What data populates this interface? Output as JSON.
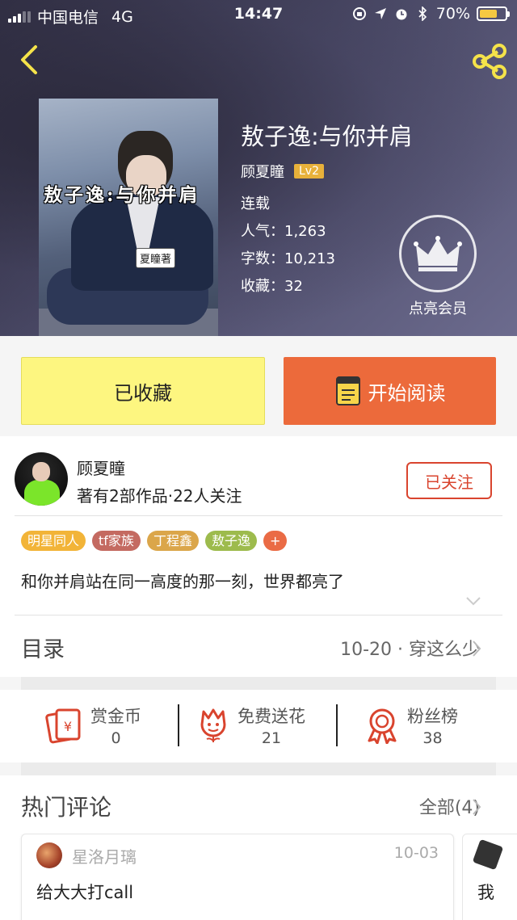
{
  "status_bar": {
    "carrier": "中国电信",
    "network": "4G",
    "time": "14:47",
    "battery": "70%",
    "battery_level": 0.7
  },
  "book": {
    "title": "敖子逸:与你并肩",
    "author": "顾夏瞳",
    "author_level": "Lv2",
    "status": "连载",
    "popularity": "人气：1,263",
    "word_count": "字数：10,213",
    "favorites": "收藏：32",
    "cover_title": "敖子逸:与你并肩",
    "cover_badge": "夏瞳著"
  },
  "vip": {
    "label": "点亮会员"
  },
  "actions": {
    "favorite_label": "已收藏",
    "read_label": "开始阅读"
  },
  "author_card": {
    "name": "顾夏瞳",
    "stats": "著有2部作品·22人关注",
    "follow_label": "已关注"
  },
  "tags": [
    {
      "label": "明星同人",
      "color": "#f2b438"
    },
    {
      "label": "tf家族",
      "color": "#c46a61"
    },
    {
      "label": "丁程鑫",
      "color": "#dba64a"
    },
    {
      "label": "敖子逸",
      "color": "#9dbb4d"
    },
    {
      "label": "+",
      "color": "#ea6b45"
    }
  ],
  "description": "和你并肩站在同一高度的那一刻，世界都亮了",
  "toc": {
    "title": "目录",
    "latest": "10-20 · 穿这么少"
  },
  "rewards": [
    {
      "label": "赏金币",
      "count": "0"
    },
    {
      "label": "免费送花",
      "count": "21"
    },
    {
      "label": "粉丝榜",
      "count": "38"
    }
  ],
  "comments": {
    "title": "热门评论",
    "all_label": "全部(4)",
    "items": [
      {
        "user": "星洛月璃",
        "date": "10-03",
        "text": "给大大打call"
      },
      {
        "text": "我"
      }
    ]
  },
  "colors": {
    "accent_red": "#d9442e",
    "read_button": "#ec6a3b",
    "favorite_button": "#fdf680",
    "level_badge": "#e8b13a"
  }
}
